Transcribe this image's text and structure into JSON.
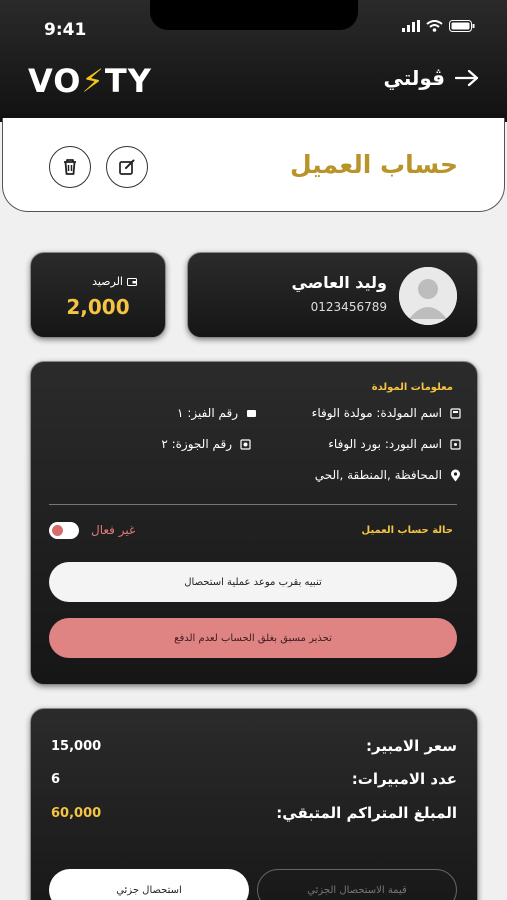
{
  "status_bar": {
    "time": "9:41"
  },
  "app_bar": {
    "logo_prefix": "VO",
    "logo_bolt": "⚡",
    "logo_suffix": "TY",
    "nav_label": "ڤولتي"
  },
  "header": {
    "title": "حساب العميل"
  },
  "balance": {
    "label": "الرصيد",
    "value": "2,000"
  },
  "customer": {
    "name": "وليد العاصي",
    "phone": "0123456789"
  },
  "generator": {
    "section_title": "معلومات المولدة",
    "generator_name": "اسم المولدة: مولدة الوفاء",
    "phase_number": "رقم الفيز: ١",
    "board_name": "اسم البورد: بورد الوفاء",
    "box_number": "رقم الجوزة: ٢",
    "location": "المحافظة ,المنطقة ,الحي",
    "status_title": "حالة حساب العميل",
    "status_value": "غير فعال",
    "status_active": false,
    "notify_button": "تنبيه بقرب موعد عملية استحصال",
    "warning_button": "تحذير مسبق بغلق الحساب لعدم الدفع"
  },
  "billing": {
    "ampere_price_label": "سعر الامبير:",
    "ampere_price_value": "15,000",
    "ampere_count_label": "عدد الامبيرات:",
    "ampere_count_value": "6",
    "remaining_label": "المبلغ المتراكم المتبقي:",
    "remaining_value": "60,000",
    "partial_value_button": "قيمة الاستحصال الجزئي",
    "partial_collect_button": "استحصال جزئي"
  },
  "colors": {
    "accent": "#b8942a",
    "gold": "#f5c542",
    "danger": "#e08383"
  }
}
